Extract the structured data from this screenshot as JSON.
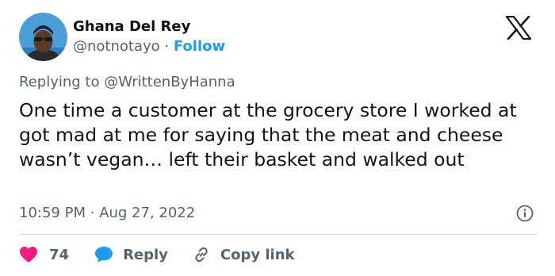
{
  "author": {
    "display_name": "Ghana Del Rey",
    "handle": "@notnotayo",
    "separator": "·",
    "follow_label": "Follow"
  },
  "reply_context": {
    "prefix": "Replying to",
    "target_handle": "@WrittenByHanna"
  },
  "tweet": {
    "text": "One time a customer at the grocery store I worked at got mad at me for saying that the meat and cheese wasn’t vegan… left their basket and walked out",
    "time": "10:59 PM",
    "separator": "·",
    "date": "Aug 27, 2022"
  },
  "actions": {
    "like_count": "74",
    "reply_label": "Reply",
    "copy_link_label": "Copy link"
  },
  "icons": {
    "avatar": "avatar-photo",
    "brand": "x-logo-icon",
    "info": "info-icon",
    "like": "heart-icon",
    "reply": "speech-bubble-icon",
    "copy": "link-icon"
  },
  "colors": {
    "text_primary": "#0f1419",
    "text_secondary": "#536471",
    "accent_blue": "#1d9bf0",
    "like_red": "#f91880",
    "divider": "#cfd9de"
  }
}
